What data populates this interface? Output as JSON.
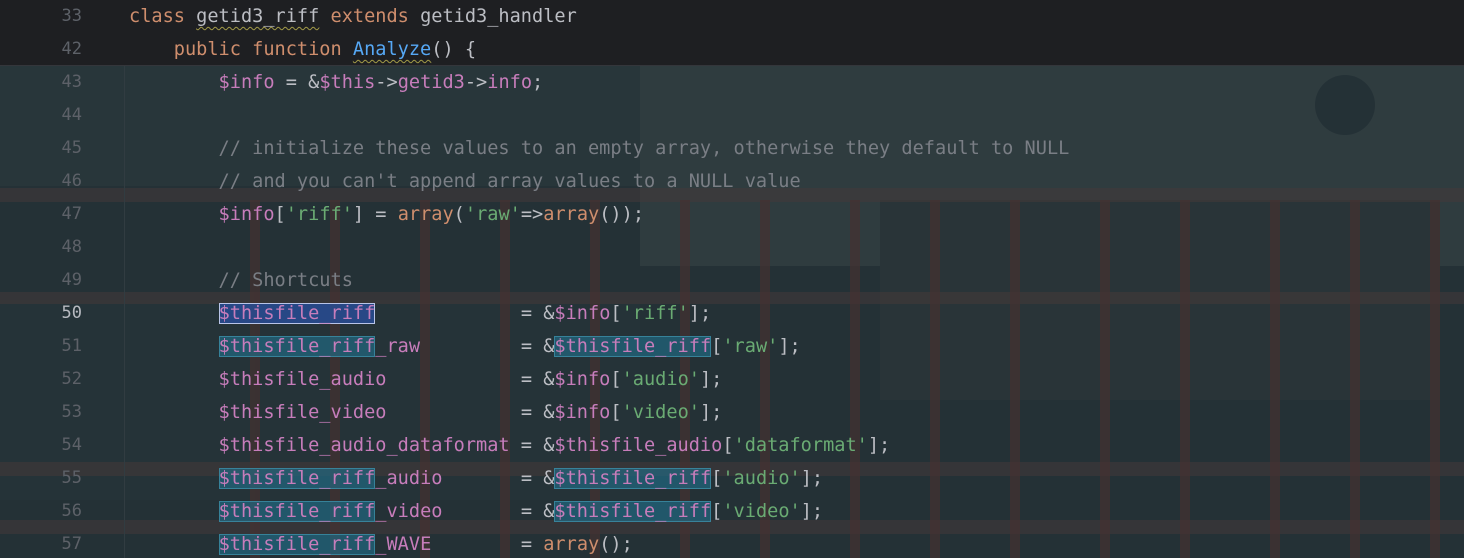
{
  "editor": {
    "sticky": [
      {
        "number": "33",
        "segments": [
          {
            "t": "class ",
            "c": "kw"
          },
          {
            "t": "getid3_riff",
            "c": "pl und"
          },
          {
            "t": " extends ",
            "c": "kw"
          },
          {
            "t": "getid3_handler",
            "c": "pl"
          }
        ]
      },
      {
        "number": "42",
        "segments": [
          {
            "t": "    public function ",
            "c": "kw"
          },
          {
            "t": "Analyze",
            "c": "fn und2"
          },
          {
            "t": "() {",
            "c": "pl"
          }
        ]
      }
    ],
    "lines": [
      {
        "number": "43",
        "segments": [
          {
            "t": "        $info",
            "c": "var"
          },
          {
            "t": " = &",
            "c": "pl"
          },
          {
            "t": "$this",
            "c": "var"
          },
          {
            "t": "->",
            "c": "pl"
          },
          {
            "t": "getid3",
            "c": "var"
          },
          {
            "t": "->",
            "c": "pl"
          },
          {
            "t": "info",
            "c": "var"
          },
          {
            "t": ";",
            "c": "pl"
          }
        ]
      },
      {
        "number": "44",
        "segments": []
      },
      {
        "number": "45",
        "segments": [
          {
            "t": "        // initialize these values to an empty array, otherwise they default to NULL",
            "c": "cmt"
          }
        ]
      },
      {
        "number": "46",
        "segments": [
          {
            "t": "        // and you can't append array values to a NULL value",
            "c": "cmt"
          }
        ]
      },
      {
        "number": "47",
        "segments": [
          {
            "t": "        $info",
            "c": "var"
          },
          {
            "t": "[",
            "c": "pl"
          },
          {
            "t": "'riff'",
            "c": "str"
          },
          {
            "t": "] = ",
            "c": "pl"
          },
          {
            "t": "array",
            "c": "kw"
          },
          {
            "t": "(",
            "c": "pl"
          },
          {
            "t": "'raw'",
            "c": "str"
          },
          {
            "t": "=>",
            "c": "pl"
          },
          {
            "t": "array",
            "c": "kw"
          },
          {
            "t": "());",
            "c": "pl"
          }
        ]
      },
      {
        "number": "48",
        "segments": []
      },
      {
        "number": "49",
        "segments": [
          {
            "t": "        // Shortcuts",
            "c": "cmt"
          }
        ]
      },
      {
        "number": "50",
        "current": true,
        "segments": [
          {
            "t": "        ",
            "c": "pl"
          },
          {
            "t": "$thisfile_riff",
            "c": "var hl-sel"
          },
          {
            "t": "             = &",
            "c": "pl"
          },
          {
            "t": "$info",
            "c": "var"
          },
          {
            "t": "[",
            "c": "pl"
          },
          {
            "t": "'riff'",
            "c": "str"
          },
          {
            "t": "];",
            "c": "pl"
          }
        ]
      },
      {
        "number": "51",
        "segments": [
          {
            "t": "        ",
            "c": "pl"
          },
          {
            "t": "$thisfile_riff",
            "c": "var hl"
          },
          {
            "t": "_raw",
            "c": "var"
          },
          {
            "t": "         = &",
            "c": "pl"
          },
          {
            "t": "$thisfile_riff",
            "c": "var hl"
          },
          {
            "t": "[",
            "c": "pl"
          },
          {
            "t": "'raw'",
            "c": "str"
          },
          {
            "t": "];",
            "c": "pl"
          }
        ]
      },
      {
        "number": "52",
        "segments": [
          {
            "t": "        $thisfile_audio",
            "c": "var"
          },
          {
            "t": "            = &",
            "c": "pl"
          },
          {
            "t": "$info",
            "c": "var"
          },
          {
            "t": "[",
            "c": "pl"
          },
          {
            "t": "'audio'",
            "c": "str"
          },
          {
            "t": "];",
            "c": "pl"
          }
        ]
      },
      {
        "number": "53",
        "segments": [
          {
            "t": "        $thisfile_video",
            "c": "var"
          },
          {
            "t": "            = &",
            "c": "pl"
          },
          {
            "t": "$info",
            "c": "var"
          },
          {
            "t": "[",
            "c": "pl"
          },
          {
            "t": "'video'",
            "c": "str"
          },
          {
            "t": "];",
            "c": "pl"
          }
        ]
      },
      {
        "number": "54",
        "segments": [
          {
            "t": "        $thisfile_audio_dataformat",
            "c": "var"
          },
          {
            "t": " = &",
            "c": "pl"
          },
          {
            "t": "$thisfile_audio",
            "c": "var"
          },
          {
            "t": "[",
            "c": "pl"
          },
          {
            "t": "'dataformat'",
            "c": "str"
          },
          {
            "t": "];",
            "c": "pl"
          }
        ]
      },
      {
        "number": "55",
        "segments": [
          {
            "t": "        ",
            "c": "pl"
          },
          {
            "t": "$thisfile_riff",
            "c": "var hl"
          },
          {
            "t": "_audio",
            "c": "var"
          },
          {
            "t": "       = &",
            "c": "pl"
          },
          {
            "t": "$thisfile_riff",
            "c": "var hl"
          },
          {
            "t": "[",
            "c": "pl"
          },
          {
            "t": "'audio'",
            "c": "str"
          },
          {
            "t": "];",
            "c": "pl"
          }
        ]
      },
      {
        "number": "56",
        "segments": [
          {
            "t": "        ",
            "c": "pl"
          },
          {
            "t": "$thisfile_riff",
            "c": "var hl"
          },
          {
            "t": "_video",
            "c": "var"
          },
          {
            "t": "       = &",
            "c": "pl"
          },
          {
            "t": "$thisfile_riff",
            "c": "var hl"
          },
          {
            "t": "[",
            "c": "pl"
          },
          {
            "t": "'video'",
            "c": "str"
          },
          {
            "t": "];",
            "c": "pl"
          }
        ]
      },
      {
        "number": "57",
        "segments": [
          {
            "t": "        ",
            "c": "pl"
          },
          {
            "t": "$thisfile_riff",
            "c": "var hl"
          },
          {
            "t": "_WAVE",
            "c": "var"
          },
          {
            "t": "        = ",
            "c": "pl"
          },
          {
            "t": "array",
            "c": "kw"
          },
          {
            "t": "();",
            "c": "pl"
          }
        ]
      }
    ]
  },
  "colors": {
    "editor_bg": "#1e1f22",
    "keyword": "#cf8e6d",
    "variable": "#c77dbb",
    "string": "#6aab73",
    "comment": "#7a7e85",
    "function": "#56a8f5",
    "plain": "#bcbec4"
  }
}
